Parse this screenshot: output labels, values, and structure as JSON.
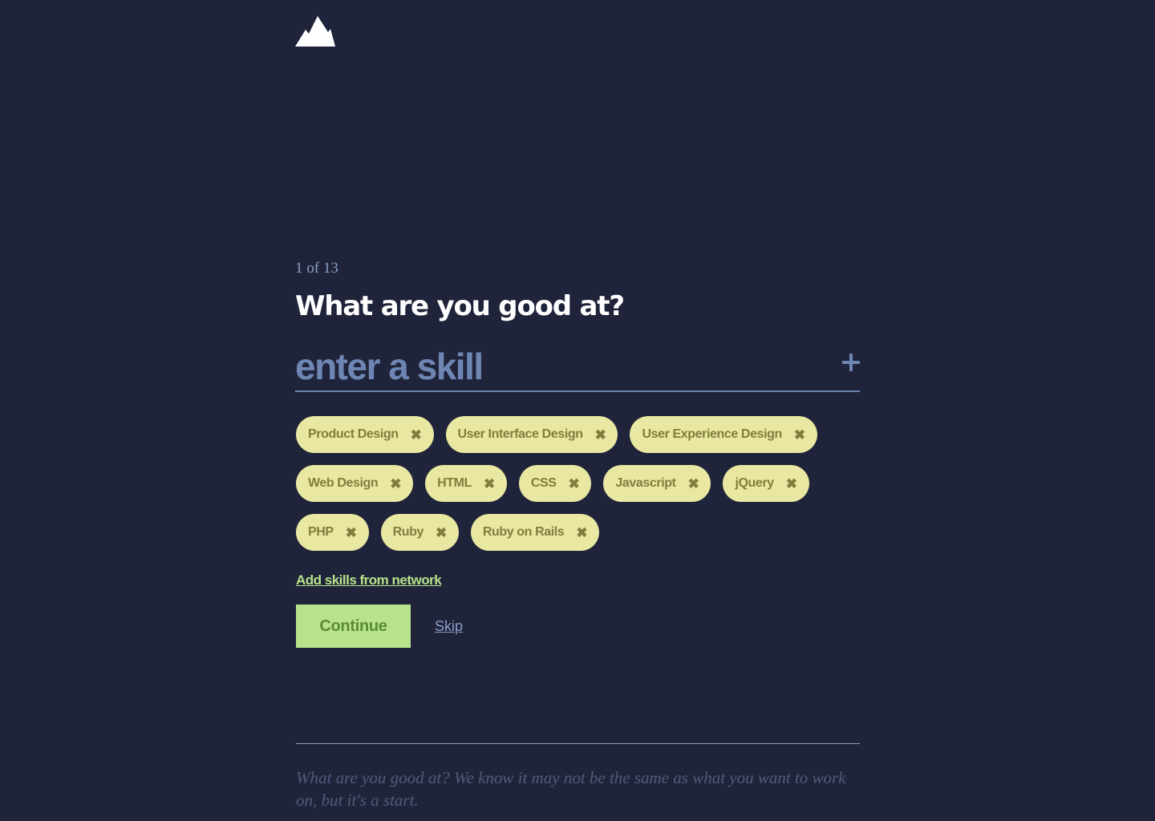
{
  "brand": {
    "logo_icon": "mountain-icon",
    "logo_color": "#ffffff"
  },
  "colors": {
    "background": "#20243a",
    "accent_blue": "#6e86b4",
    "tag_background": "#e9e8a2",
    "tag_text": "#7f7e3c",
    "accent_green": "#b6e38b"
  },
  "step": {
    "label": "1 of 13"
  },
  "question": {
    "title": "What are you good at?"
  },
  "skill_input": {
    "placeholder": "enter a skill",
    "value": "",
    "add_icon": "plus-icon"
  },
  "skills": [
    [
      {
        "label": "Product Design",
        "remove_icon": "close-icon",
        "remove_glyph": "✖"
      },
      {
        "label": "User Interface Design",
        "remove_icon": "close-icon",
        "remove_glyph": "✖"
      },
      {
        "label": "User Experience Design",
        "remove_icon": "close-icon",
        "remove_glyph": "✖"
      }
    ],
    [
      {
        "label": "Web Design",
        "remove_icon": "close-icon",
        "remove_glyph": "✖"
      },
      {
        "label": "HTML",
        "remove_icon": "close-icon",
        "remove_glyph": "✖"
      },
      {
        "label": "CSS",
        "remove_icon": "close-icon",
        "remove_glyph": "✖"
      },
      {
        "label": "Javascript",
        "remove_icon": "close-icon",
        "remove_glyph": "✖"
      },
      {
        "label": "jQuery",
        "remove_icon": "close-icon",
        "remove_glyph": "✖"
      }
    ],
    [
      {
        "label": "PHP",
        "remove_icon": "close-icon",
        "remove_glyph": "✖"
      },
      {
        "label": "Ruby",
        "remove_icon": "close-icon",
        "remove_glyph": "✖"
      },
      {
        "label": "Ruby on Rails",
        "remove_icon": "close-icon",
        "remove_glyph": "✖"
      }
    ]
  ],
  "links": {
    "add_from_network": "Add skills from network"
  },
  "actions": {
    "continue_label": "Continue",
    "skip_label": "Skip"
  },
  "footer": {
    "note": "What are you good at? We know it may not be the same as what you want to work on, but it's a start."
  }
}
